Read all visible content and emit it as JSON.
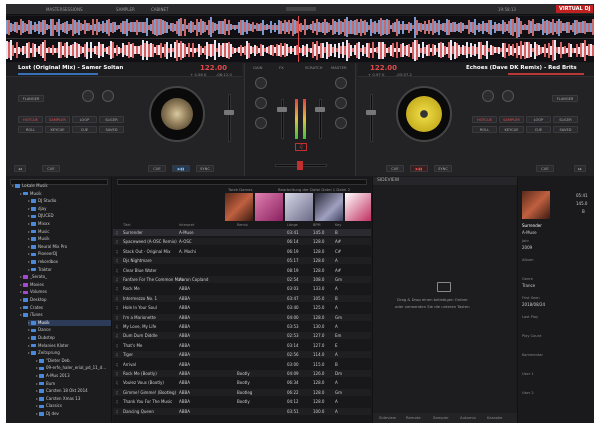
{
  "titlebar": {
    "left1": "MASTERSESSIONS",
    "left2": "SAMPLER",
    "left3": "CABINET",
    "time": "19:58:13",
    "logo": "VIRTUAL DJ"
  },
  "deck_left": {
    "title": "Lost (Original Mix) - Samer Soltan",
    "bpm": "122.00",
    "key_info": "+ 4.56 K",
    "time": "-08:12.0",
    "pad_mode": "FLANGER",
    "buttons": [
      "HOTCUE",
      "SAMPLER",
      "LOOP",
      "SLICER",
      "ROLL",
      "KEYCUE",
      "CUE",
      "SAVED"
    ]
  },
  "deck_right": {
    "title": "Echoes (Dave DK Remix) - Red Brits",
    "bpm": "122.00",
    "key_info": "+ 0.97 K",
    "time": "-03:57.2",
    "pad_mode": "FLANGER",
    "buttons": [
      "HOTCUE",
      "SAMPLER",
      "LOOP",
      "SLICER",
      "ROLL",
      "KEYCUE",
      "CUE",
      "SAVED"
    ]
  },
  "transport": {
    "cue": "CUE",
    "play": "▶▮▮",
    "sync": "SYNC"
  },
  "mixer_labels": [
    "GAIN",
    "FX",
    "SCRATCH",
    "MASTER"
  ],
  "browser_tree": [
    {
      "label": "Lokale Musik",
      "indent": 0
    },
    {
      "label": "Musik",
      "indent": 1
    },
    {
      "label": "DJ Studio",
      "indent": 2
    },
    {
      "label": "djay",
      "indent": 2
    },
    {
      "label": "DJUCED",
      "indent": 2
    },
    {
      "label": "Mixxx",
      "indent": 2
    },
    {
      "label": "Music",
      "indent": 2
    },
    {
      "label": "Musik",
      "indent": 2
    },
    {
      "label": "Neural Mix Pro",
      "indent": 2
    },
    {
      "label": "PioneerDJ",
      "indent": 2
    },
    {
      "label": "rekordbox",
      "indent": 2
    },
    {
      "label": "Traktor",
      "indent": 2
    },
    {
      "label": "_Serato_",
      "indent": 1,
      "purple": true
    },
    {
      "label": "Movies",
      "indent": 1,
      "purple": true
    },
    {
      "label": "Volumes",
      "indent": 1,
      "purple": true
    },
    {
      "label": "Desktop",
      "indent": 1
    },
    {
      "label": "Crates",
      "indent": 1
    },
    {
      "label": "iTunes",
      "indent": 1
    },
    {
      "label": "Musik",
      "indent": 2,
      "selected": true
    },
    {
      "label": "Dance",
      "indent": 2
    },
    {
      "label": "Dubstep",
      "indent": 2
    },
    {
      "label": "Melanies Kloter",
      "indent": 2
    },
    {
      "label": "Zeitsprung",
      "indent": 2
    },
    {
      "label": "\"Dieter Deb.",
      "indent": 3
    },
    {
      "label": "09-erfe_haler_erial_pd_11_d...",
      "indent": 3
    },
    {
      "label": "A-Mus 2013",
      "indent": 3
    },
    {
      "label": "Bum",
      "indent": 3
    },
    {
      "label": "Carsten 18 Okt 2014",
      "indent": 3
    },
    {
      "label": "Carsten Xmas 13",
      "indent": 3
    },
    {
      "label": "Classics",
      "indent": 3
    },
    {
      "label": "DJ dev",
      "indent": 3
    }
  ],
  "tracklist": {
    "header": {
      "cover": "Tarek Dames",
      "folder": "Bearbeitung der Datei Datei 1 Datei 2"
    },
    "columns": [
      "Titel",
      "Interpret",
      "Remix",
      "Länge",
      "BPM",
      "Key"
    ],
    "rows": [
      [
        "Surrender",
        "A-Muse",
        "",
        "03:41",
        "145.0",
        "B"
      ],
      [
        "Spaceweed (A-OSC Remix)",
        "A-OSC",
        "",
        "06:14",
        "128.0",
        "A#"
      ],
      [
        "Stack Out - Original Mix",
        "A. Mochi",
        "",
        "06:19",
        "128.0",
        "C#"
      ],
      [
        "Djs Nightmare",
        "",
        "",
        "05:17",
        "128.0",
        "A"
      ],
      [
        "Clear Blue Water",
        "",
        "",
        "08:19",
        "128.0",
        "A#"
      ],
      [
        "Fanfare For The Common Man",
        "Aaron Copland",
        "",
        "02:54",
        "108.0",
        "Gm"
      ],
      [
        "Rock Me",
        "ABBA",
        "",
        "03:03",
        "133.0",
        "A"
      ],
      [
        "Intermezzo No. 1",
        "ABBA",
        "",
        "03:47",
        "105.0",
        "B"
      ],
      [
        "Hole In Your Soul",
        "ABBA",
        "",
        "03:40",
        "125.0",
        "A"
      ],
      [
        "I'm a Marionette",
        "ABBA",
        "",
        "04:00",
        "128.0",
        "Gm"
      ],
      [
        "My Love, My Life",
        "ABBA",
        "",
        "03:53",
        "130.0",
        "A"
      ],
      [
        "Dum Dum Diddle",
        "ABBA",
        "",
        "02:53",
        "127.0",
        "Em"
      ],
      [
        "That's Me",
        "ABBA",
        "",
        "03:14",
        "127.0",
        "E"
      ],
      [
        "Tiger",
        "ABBA",
        "",
        "02:56",
        "114.0",
        "A"
      ],
      [
        "Arrival",
        "ABBA",
        "",
        "03:00",
        "115.0",
        "B"
      ],
      [
        "Rock Me (Bootly)",
        "ABBA",
        "Bootly",
        "04:09",
        "126.0",
        "Dm"
      ],
      [
        "Voulez Vous (Bootly)",
        "ABBA",
        "Bootly",
        "06:34",
        "128.0",
        "A"
      ],
      [
        "Gimme! Gimme! (Bootleg)",
        "ABBA",
        "Bootleg",
        "06:22",
        "128.0",
        "Gm"
      ],
      [
        "Thank You For The Music",
        "ABBA",
        "Bootly",
        "04:12",
        "128.0",
        "A"
      ],
      [
        "Dancing Queen",
        "ABBA",
        "",
        "03:51",
        "100.0",
        "A"
      ]
    ]
  },
  "sideview": {
    "title": "SIDEVIEW",
    "drop_line1": "Drag & Drop einen beliebigen Ordner",
    "drop_line2": "oder verwenden Sie die unteren Tasten",
    "tabs": [
      "Sideview",
      "Remote",
      "Sampler",
      "Automix",
      "Karaoke"
    ]
  },
  "info_panel": {
    "time": "05:41",
    "bpm": "145.0",
    "key": "B",
    "title": "Surrender",
    "artist": "A-Muse",
    "fields": [
      {
        "label": "Jahr",
        "value": "2009"
      },
      {
        "label": "Album",
        "value": ""
      },
      {
        "label": "Genre",
        "value": "Trance"
      },
      {
        "label": "First Seen",
        "value": "2018/08/24"
      },
      {
        "label": "Last Play",
        "value": ""
      },
      {
        "label": "Play Count",
        "value": ""
      },
      {
        "label": "Kommentar",
        "value": ""
      },
      {
        "label": "User 1",
        "value": ""
      },
      {
        "label": "User 2",
        "value": ""
      }
    ]
  },
  "colors": {
    "accent": "#e04a4a",
    "folder": "#4a88d8",
    "selected": "#2c3c58"
  }
}
